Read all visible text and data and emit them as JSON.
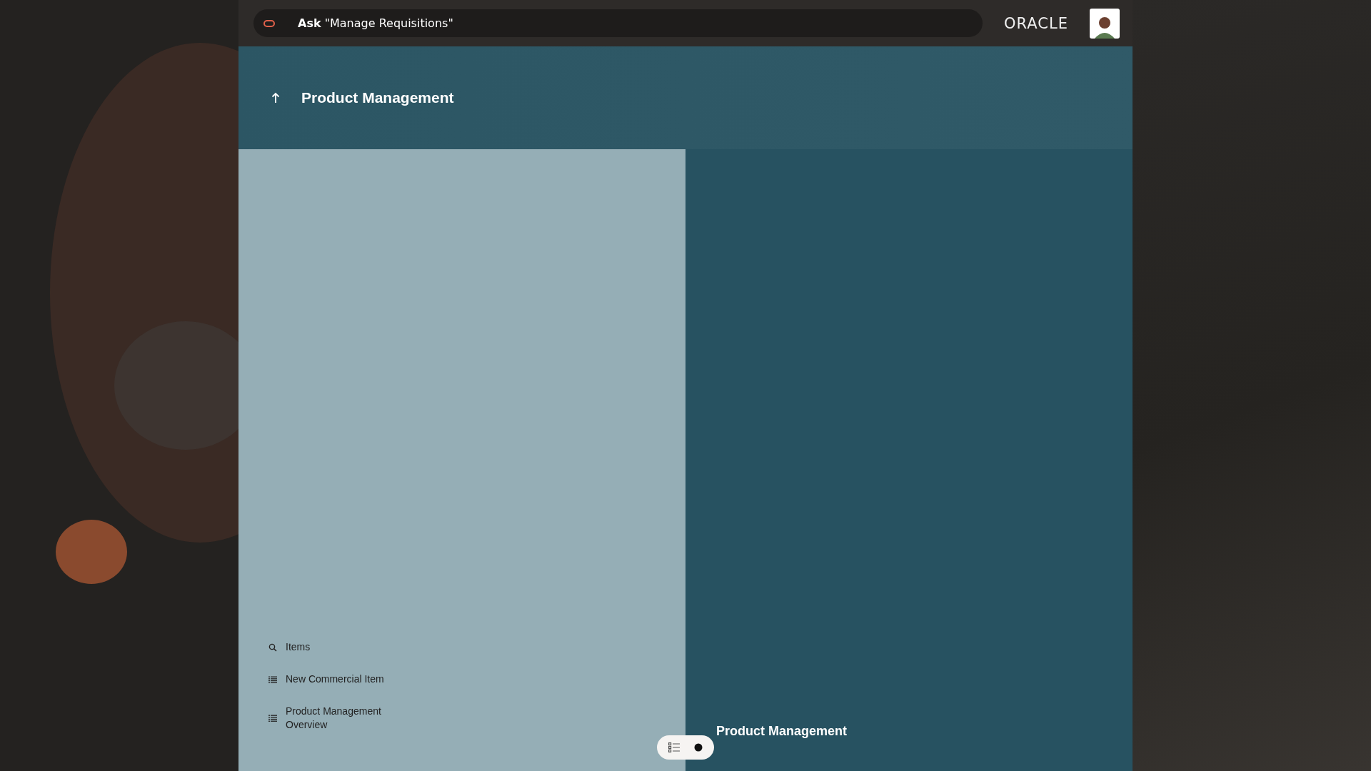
{
  "top_bar": {
    "search": "**Ask** \"Manage Requisitions\"",
    "logo": "ORACLE"
  },
  "header": {
    "title": "Product Management"
  },
  "quick_actions": [
    {
      "kind": "search",
      "label": "Items"
    },
    {
      "kind": "list",
      "label": "New Commercial Item"
    },
    {
      "kind": "list",
      "label": "Product Management Overview"
    }
  ],
  "feature_panel": {
    "title": "Product Management"
  }
}
